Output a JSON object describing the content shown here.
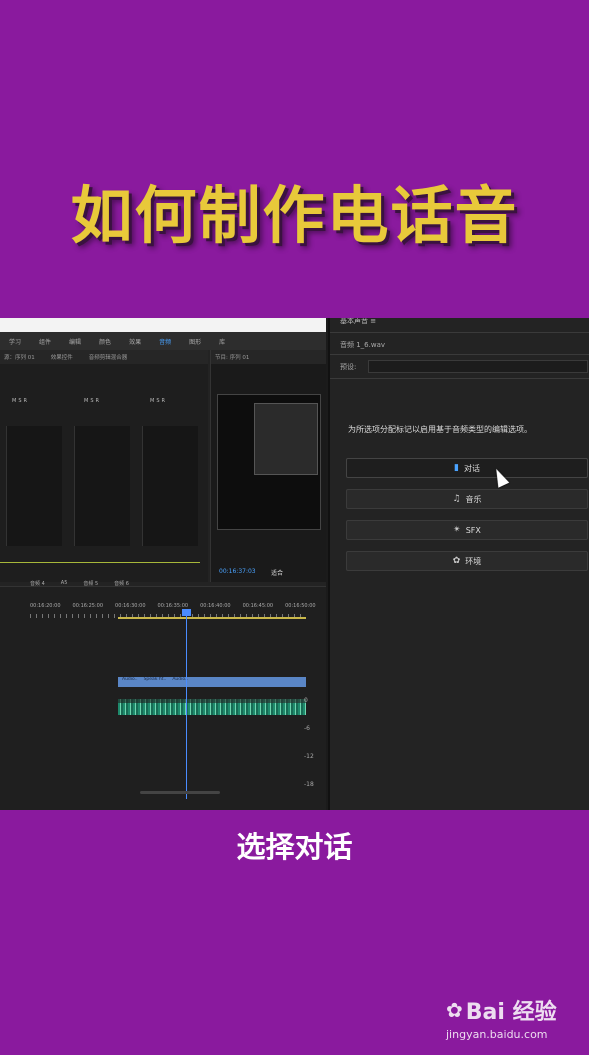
{
  "header": {
    "title": "如何制作电话音"
  },
  "left_panel": {
    "workspaces": [
      "学习",
      "组件",
      "编辑",
      "颜色",
      "效果",
      "音频",
      "图形",
      "库"
    ],
    "active_workspace_index": 5,
    "mixer_header": [
      "源：序列 01",
      "效果控件",
      "音频剪辑混合器"
    ],
    "channel_controls": [
      "M",
      "S",
      "R"
    ],
    "channel_footer": [
      "音频 4",
      "A5",
      "音频 5",
      "音频 6"
    ],
    "monitor_header": "节目: 序列 01",
    "monitor_timecode": "00:16:37:03",
    "monitor_fit": "适合",
    "ruler_labels": [
      "00:16:20:00",
      "00:16:25:00",
      "00:16:30:00",
      "00:16:35:00",
      "00:16:40:00",
      "00:16:45:00",
      "00:16:50:00"
    ],
    "clips": [
      "Audio..",
      "Speak ht..",
      "Audio.."
    ],
    "meter_labels": [
      "0",
      "-6",
      "-12",
      "-18"
    ]
  },
  "right_panel": {
    "panel_title": "基本声音 ≡",
    "file_name": "音频 1_6.wav",
    "preset_label": "预设:",
    "hint": "为所选项分配标记以启用基于音频类型的编辑选项。",
    "buttons": [
      {
        "label": "对话",
        "icon": "dialogue-icon"
      },
      {
        "label": "音乐",
        "icon": "music-icon"
      },
      {
        "label": "SFX",
        "icon": "sfx-icon"
      },
      {
        "label": "环境",
        "icon": "ambience-icon"
      }
    ]
  },
  "caption": {
    "text": "选择对话"
  },
  "watermark": {
    "brand": "Bai 经验",
    "url": "jingyan.baidu.com"
  },
  "colors": {
    "background": "#8a1a9e",
    "title": "#e8c93a",
    "accent_blue": "#4aa3ff"
  }
}
